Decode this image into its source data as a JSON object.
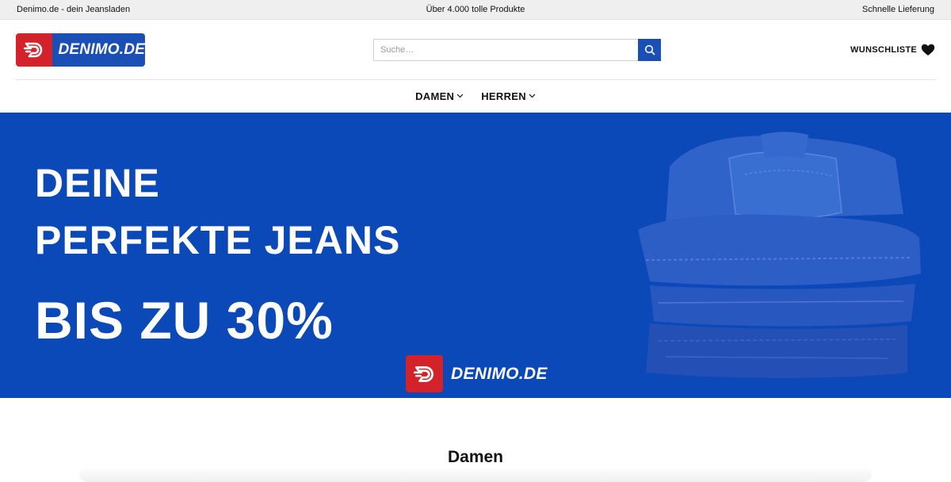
{
  "topbar": {
    "left": "Denimo.de - dein Jeansladen",
    "center": "Über 4.000 tolle Produkte",
    "right": "Schnelle Lieferung"
  },
  "header": {
    "logo_text": "DENIMO.DE",
    "search": {
      "placeholder": "Suche…",
      "value": ""
    },
    "wishlist_label": "WUNSCHLISTE"
  },
  "nav": {
    "items": [
      {
        "label": "DAMEN"
      },
      {
        "label": "HERREN"
      }
    ]
  },
  "hero": {
    "line1": "DEINE",
    "line2": "PERFEKTE JEANS",
    "line3": "BIS ZU 30%",
    "logo_text": "DENIMO.DE"
  },
  "section": {
    "title": "Damen"
  },
  "icons": {
    "search": "search-icon",
    "wishlist": "heart-icon",
    "dropdown": "chevron-down-icon",
    "logo": "denimo-d-logo-icon"
  },
  "colors": {
    "brand_blue": "#1a4fb5",
    "hero_blue": "#0b48b8",
    "brand_red": "#d3222a",
    "topbar_bg": "#efefef"
  }
}
